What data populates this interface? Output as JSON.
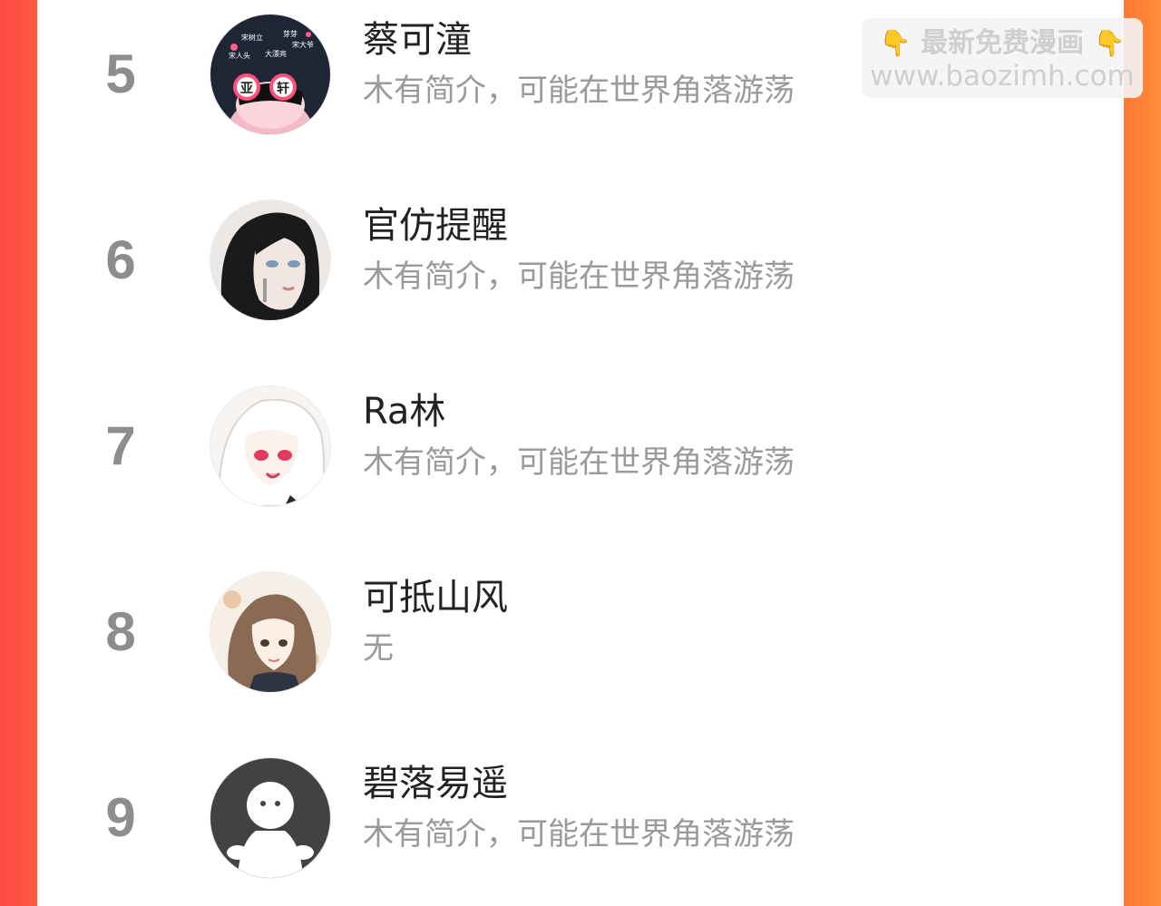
{
  "watermark": {
    "title": "最新免费漫画",
    "url": "www.baozimh.com",
    "icon": "pointing-down-hand-icon"
  },
  "colors": {
    "background_left": "#ff4747",
    "background_right": "#ff8f3b",
    "rank": "#8d8d8d",
    "username": "#222222",
    "bio": "#9a9a9a"
  },
  "ranking": {
    "items": [
      {
        "rank": "5",
        "username": "蔡可潼",
        "bio": "木有简介，可能在世界角落游荡",
        "avatar": {
          "icon": "anime-avatar-icon",
          "labels": [
            "宋树立",
            "芽芽",
            "宋大爷",
            "宋人头",
            "大漂亮",
            "亚",
            "轩"
          ]
        }
      },
      {
        "rank": "6",
        "username": "官仿提醒",
        "bio": "木有简介，可能在世界角落游荡",
        "avatar": {
          "icon": "dark-hair-girl-avatar-icon"
        }
      },
      {
        "rank": "7",
        "username": "Ra林",
        "bio": "木有简介，可能在世界角落游荡",
        "avatar": {
          "icon": "white-hair-girl-avatar-icon"
        }
      },
      {
        "rank": "8",
        "username": "可抵山风",
        "bio": "无",
        "avatar": {
          "icon": "brown-hair-girl-avatar-icon"
        }
      },
      {
        "rank": "9",
        "username": "碧落易遥",
        "bio": "木有简介，可能在世界角落游荡",
        "avatar": {
          "icon": "default-user-avatar-icon"
        }
      }
    ]
  }
}
